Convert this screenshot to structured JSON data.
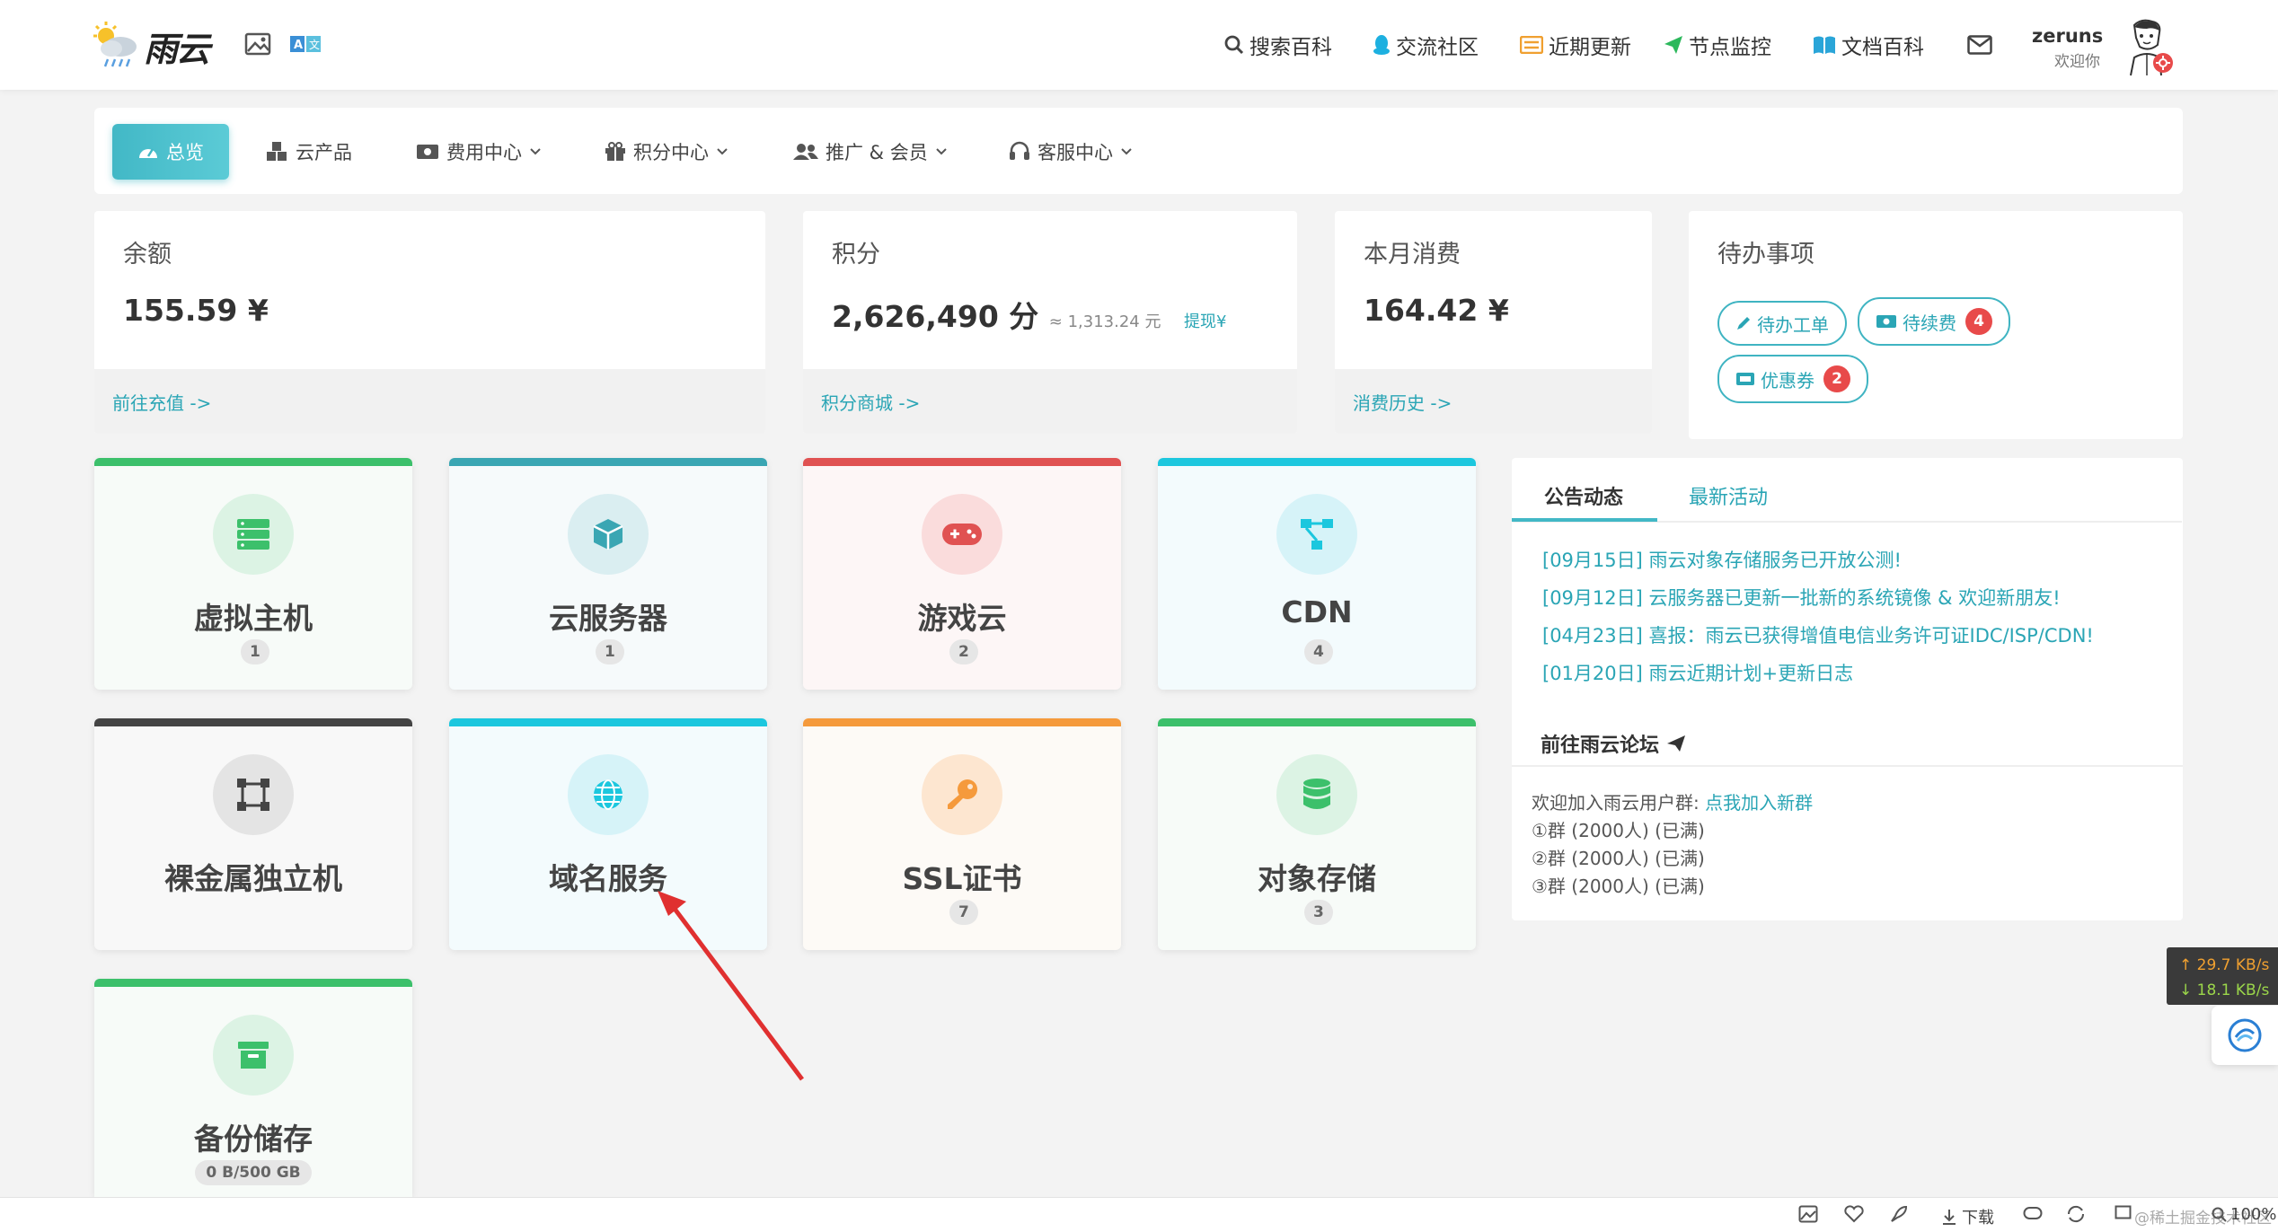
{
  "app": {
    "logo_text": "雨云",
    "user": {
      "name": "zeruns",
      "welcome": "欢迎你"
    }
  },
  "header": {
    "nav": [
      {
        "label": "搜索百科",
        "icon": "search-icon"
      },
      {
        "label": "交流社区",
        "icon": "qq-icon"
      },
      {
        "label": "近期更新",
        "icon": "list-icon"
      },
      {
        "label": "节点监控",
        "icon": "send-icon"
      },
      {
        "label": "文档百科",
        "icon": "book-icon"
      }
    ],
    "mail_icon": "mail-icon"
  },
  "menu": {
    "items": [
      {
        "label": "总览",
        "icon": "dashboard-icon",
        "active": true
      },
      {
        "label": "云产品",
        "icon": "cubes-icon"
      },
      {
        "label": "费用中心",
        "icon": "money-icon",
        "dropdown": true
      },
      {
        "label": "积分中心",
        "icon": "gift-icon",
        "dropdown": true
      },
      {
        "label": "推广 & 会员",
        "icon": "users-icon",
        "dropdown": true
      },
      {
        "label": "客服中心",
        "icon": "headset-icon",
        "dropdown": true
      }
    ]
  },
  "stats": {
    "balance": {
      "label": "余额",
      "value": "155.59 ¥",
      "link": "前往充值 ->"
    },
    "points": {
      "label": "积分",
      "value": "2,626,490 分",
      "approx": "≈ 1,313.24 元",
      "withdraw": "提现¥",
      "link": "积分商城 ->"
    },
    "monthly": {
      "label": "本月消费",
      "value": "164.42 ¥",
      "link": "消费历史 ->"
    },
    "todo": {
      "label": "待办事项",
      "tickets": "待办工单",
      "renew": "待续费",
      "renew_count": "4",
      "coupons": "优惠券",
      "coupons_count": "2"
    }
  },
  "products": [
    {
      "name": "虚拟主机",
      "count": "1",
      "color": "#3cc06b",
      "icon": "server-icon"
    },
    {
      "name": "云服务器",
      "count": "1",
      "color": "#3aa6b3",
      "icon": "cube-icon"
    },
    {
      "name": "游戏云",
      "count": "2",
      "color": "#e05252",
      "icon": "gamepad-icon"
    },
    {
      "name": "CDN",
      "count": "4",
      "color": "#1cc7de",
      "icon": "network-icon"
    },
    {
      "name": "裸金属独立机",
      "count": "",
      "color": "#444444",
      "icon": "bare-metal-icon"
    },
    {
      "name": "域名服务",
      "count": "",
      "color": "#1cc7de",
      "icon": "globe-icon"
    },
    {
      "name": "SSL证书",
      "count": "7",
      "color": "#f59a3c",
      "icon": "key-icon"
    },
    {
      "name": "对象存储",
      "count": "3",
      "color": "#3cc06b",
      "icon": "database-icon"
    },
    {
      "name": "备份储存",
      "count": "0 B/500 GB",
      "color": "#3cc06b",
      "icon": "archive-icon"
    }
  ],
  "announcements": {
    "tab_active": "公告动态",
    "tab_other": "最新活动",
    "items": [
      "[09月15日] 雨云对象存储服务已开放公测!",
      "[09月12日] 云服务器已更新一批新的系统镜像 & 欢迎新朋友!",
      "[04月23日] 喜报：雨云已获得增值电信业务许可证IDC/ISP/CDN!",
      "[01月20日] 雨云近期计划+更新日志"
    ],
    "forum": "前往雨云论坛",
    "groups_intro": "欢迎加入雨云用户群: ",
    "groups_link": "点我加入新群",
    "groups": [
      "①群 (2000人) (已满)",
      "②群 (2000人) (已满)",
      "③群 (2000人) (已满)"
    ]
  },
  "speed": {
    "up": "↑ 29.7 KB/s",
    "down": "↓ 18.1 KB/s"
  },
  "statusbar": {
    "download": "下载",
    "zoom": "100%",
    "watermark": "@稀土掘金技术社区"
  },
  "colors": {
    "accent": "#42b8c6",
    "link": "#2aa5b5",
    "badge": "#e84a4a"
  }
}
